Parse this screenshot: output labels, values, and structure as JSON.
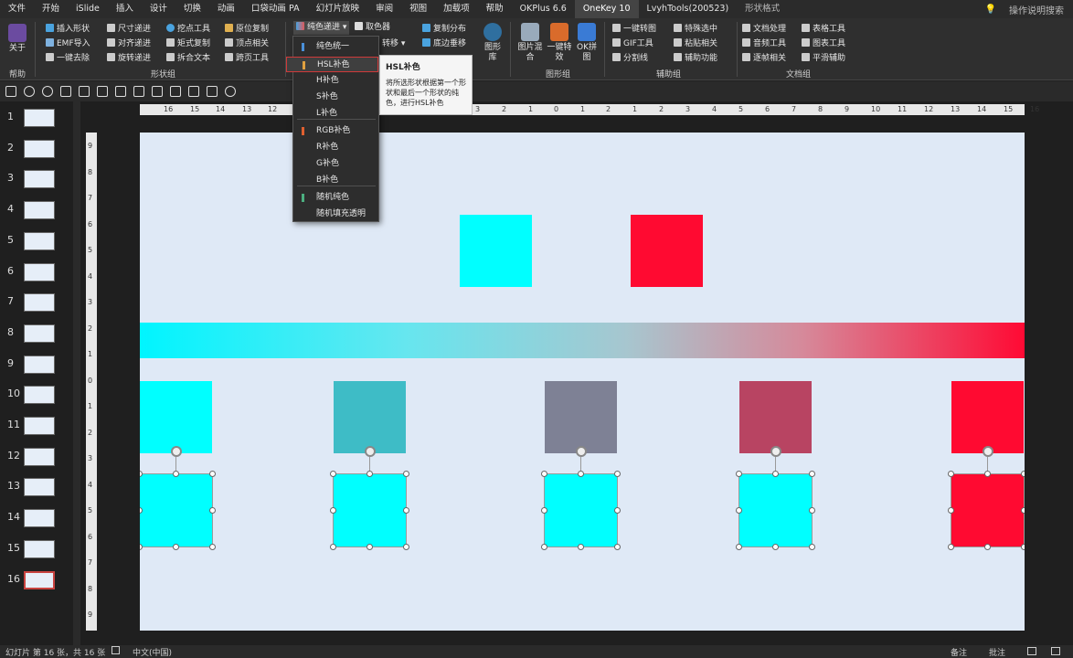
{
  "menu": {
    "tabs": [
      "文件",
      "开始",
      "iSlide",
      "插入",
      "设计",
      "切换",
      "动画",
      "口袋动画 PA",
      "幻灯片放映",
      "审阅",
      "视图",
      "加载项",
      "帮助",
      "OKPlus 6.6",
      "OneKey 10",
      "LvyhTools(200523)",
      "形状格式"
    ],
    "active_tab": "OneKey 10",
    "search": "操作说明搜索"
  },
  "ribbon": {
    "about": "关于",
    "help_group": "帮助",
    "col1": [
      "插入形状",
      "EMF导入",
      "一键去除"
    ],
    "col2": [
      "尺寸递进",
      "对齐递进",
      "旋转递进"
    ],
    "col3": [
      "挖点工具",
      "矩式复制",
      "拆合文本"
    ],
    "col4": [
      "原位复制",
      "顶点相关",
      "跨页工具"
    ],
    "shape_group": "形状组",
    "color_btn": "纯色递进",
    "picker_btn": "取色器",
    "col6": [
      "复制分布",
      "底边垂移"
    ],
    "partial_transfer": "转移",
    "lib_btn": "图形库",
    "img_merge": "图片混合",
    "one_key_effect": "一键特效",
    "ok_puzzle": "OK拼图",
    "graphics_group": "图形组",
    "col8": [
      "一键转图",
      "GIF工具",
      "分割线"
    ],
    "col9": [
      "特殊选中",
      "粘贴相关",
      "辅助功能"
    ],
    "aux_group": "辅助组",
    "col10": [
      "文档处理",
      "音频工具",
      "逐帧相关"
    ],
    "col11": [
      "表格工具",
      "图表工具",
      "平滑辅助"
    ],
    "doc_group": "文档组"
  },
  "dropdown": {
    "items": [
      "纯色统一",
      "HSL补色",
      "H补色",
      "S补色",
      "L补色",
      "RGB补色",
      "R补色",
      "G补色",
      "B补色",
      "随机纯色",
      "随机填充透明"
    ],
    "highlighted": "HSL补色"
  },
  "tooltip": {
    "title": "HSL补色",
    "desc": "将所选形状根据第一个形状和最后一个形状的纯色，进行HSL补色"
  },
  "thumbnails": [
    "1",
    "2",
    "3",
    "4",
    "5",
    "6",
    "7",
    "8",
    "9",
    "10",
    "11",
    "12",
    "13",
    "14",
    "15",
    "16"
  ],
  "hruler_ticks": [
    "16",
    "15",
    "14",
    "13",
    "12",
    "1",
    "2",
    "3",
    "4",
    "5",
    "6",
    "7",
    "8",
    "9",
    "10",
    "11",
    "12",
    "13",
    "14",
    "15",
    "16"
  ],
  "hruler_mid": [
    "3",
    "2",
    "1",
    "0",
    "1",
    "2"
  ],
  "vruler_ticks": [
    "9",
    "8",
    "7",
    "6",
    "5",
    "4",
    "3",
    "2",
    "1",
    "0",
    "1",
    "2",
    "3",
    "4",
    "5",
    "6",
    "7",
    "8",
    "9"
  ],
  "colors": {
    "top_left": "#00ffff",
    "top_right": "#ff0a31",
    "row1": [
      "#00ffff",
      "#3ebcc6",
      "#7e8195",
      "#b84462",
      "#ff0a31"
    ],
    "row2": [
      "#00ffff",
      "#00ffff",
      "#00ffff",
      "#00ffff",
      "#ff0a31"
    ]
  },
  "status": {
    "slide_info": "幻灯片 第 16 张，共 16 张",
    "language": "中文(中国)",
    "notes": "备注",
    "comments": "批注"
  }
}
